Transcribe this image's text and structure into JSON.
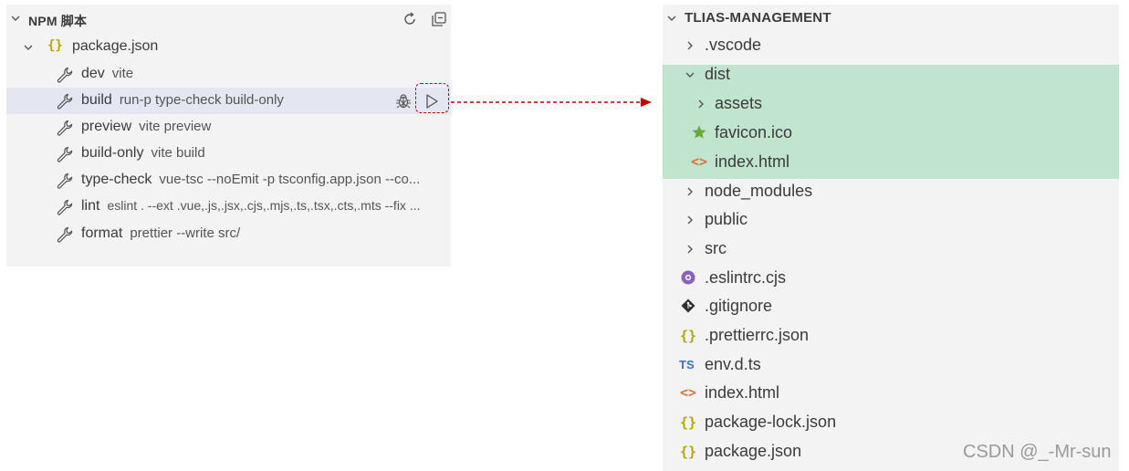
{
  "npm": {
    "title": "NPM 脚本",
    "package": "package.json",
    "scripts": [
      {
        "name": "dev",
        "cmd": "vite"
      },
      {
        "name": "build",
        "cmd": "run-p type-check build-only"
      },
      {
        "name": "preview",
        "cmd": "vite preview"
      },
      {
        "name": "build-only",
        "cmd": "vite build"
      },
      {
        "name": "type-check",
        "cmd": "vue-tsc --noEmit -p tsconfig.app.json --co..."
      },
      {
        "name": "lint",
        "cmd": "eslint . --ext .vue,.js,.jsx,.cjs,.mjs,.ts,.tsx,.cts,.mts --fix ..."
      },
      {
        "name": "format",
        "cmd": "prettier --write src/"
      }
    ]
  },
  "explorer": {
    "title": "TLIAS-MANAGEMENT",
    "items": [
      {
        "label": ".vscode",
        "type": "folder"
      },
      {
        "label": "dist",
        "type": "folder-open"
      },
      {
        "label": "assets",
        "type": "folder"
      },
      {
        "label": "favicon.ico",
        "type": "favicon"
      },
      {
        "label": "index.html",
        "type": "html"
      },
      {
        "label": "node_modules",
        "type": "folder"
      },
      {
        "label": "public",
        "type": "folder"
      },
      {
        "label": "src",
        "type": "folder"
      },
      {
        "label": ".eslintrc.cjs",
        "type": "eslint"
      },
      {
        "label": ".gitignore",
        "type": "git"
      },
      {
        "label": ".prettierrc.json",
        "type": "json"
      },
      {
        "label": "env.d.ts",
        "type": "ts"
      },
      {
        "label": "index.html",
        "type": "html"
      },
      {
        "label": "package-lock.json",
        "type": "json"
      },
      {
        "label": "package.json",
        "type": "json"
      }
    ]
  },
  "watermark": "CSDN @_-Mr-sun",
  "colors": {
    "highlight": "#c1e4cf",
    "arrow": "#c00000",
    "json": "#b5a30f",
    "ts": "#3178c6",
    "html": "#d4753a",
    "eslint": "#8b5fbf",
    "favicon": "#6aaa3a"
  }
}
